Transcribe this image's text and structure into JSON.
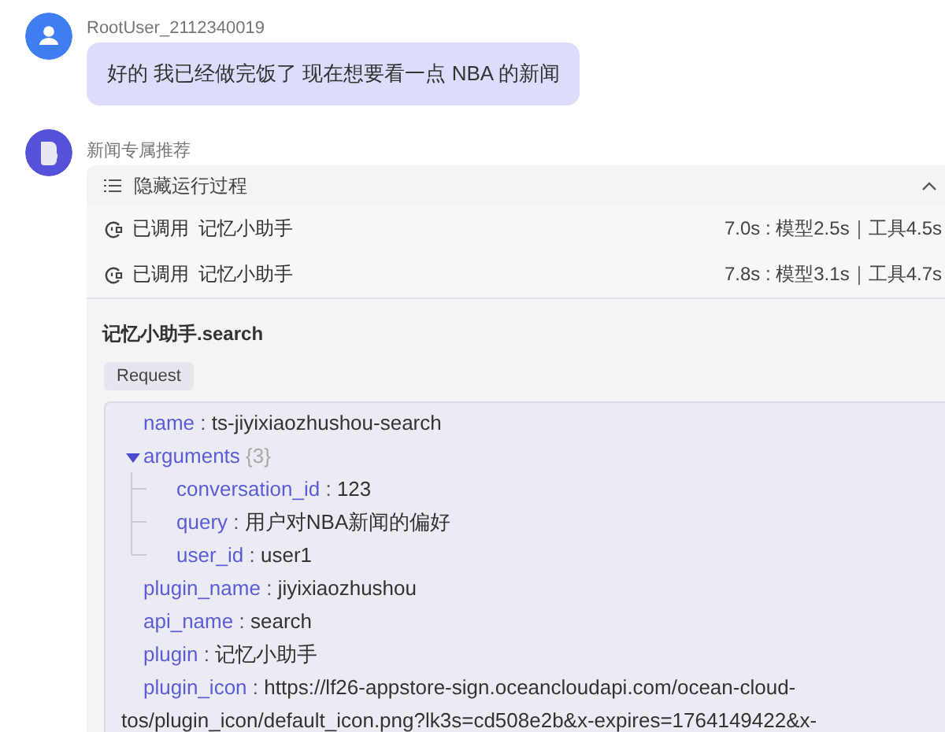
{
  "user_message": {
    "author": "RootUser_2112340019",
    "text": "好的 我已经做完饭了 现在想要看一点 NBA 的新闻"
  },
  "bot_message": {
    "author": "新闻专属推荐",
    "process": {
      "toggle_label": "隐藏运行过程",
      "expanded": true,
      "calls": [
        {
          "label": "已调用",
          "tool": "记忆小助手",
          "timing": "7.0s : 模型2.5s｜工具4.5s"
        },
        {
          "label": "已调用",
          "tool": "记忆小助手",
          "timing": "7.8s : 模型3.1s｜工具4.7s"
        }
      ]
    },
    "detail": {
      "title": "记忆小助手.search",
      "tab": "Request",
      "separator": ":",
      "fields": [
        {
          "key": "name",
          "value": "ts-jiyixiaozhushou-search"
        },
        {
          "key": "arguments",
          "count": "{3}",
          "expanded": true,
          "children": [
            {
              "key": "conversation_id",
              "value": "123"
            },
            {
              "key": "query",
              "value": "用户对NBA新闻的偏好"
            },
            {
              "key": "user_id",
              "value": "user1"
            }
          ]
        },
        {
          "key": "plugin_name",
          "value": "jiyixiaozhushou"
        },
        {
          "key": "api_name",
          "value": "search"
        },
        {
          "key": "plugin",
          "value": "记忆小助手"
        },
        {
          "key": "plugin_icon",
          "value": "https://lf26-appstore-sign.oceancloudapi.com/ocean-cloud-tos/plugin_icon/default_icon.png?lk3s=cd508e2b&x-expires=1764149422&x-"
        }
      ]
    }
  }
}
